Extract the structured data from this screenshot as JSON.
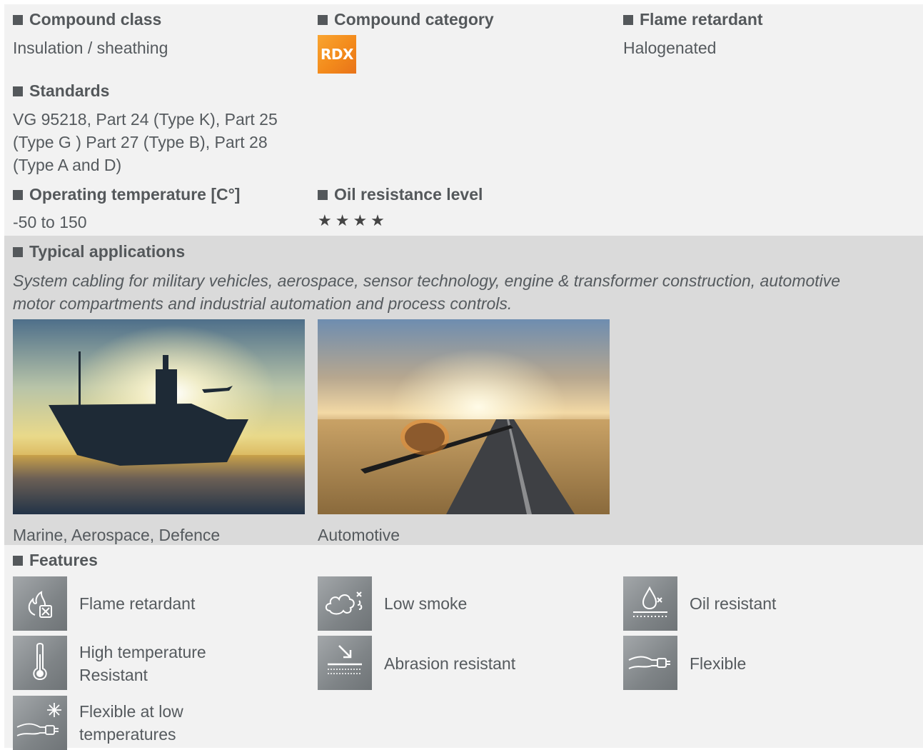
{
  "compound_class": {
    "label": "Compound class",
    "value": "Insulation / sheathing"
  },
  "compound_category": {
    "label": "Compound category",
    "badge": "RDX",
    "badge_color": "#f39222"
  },
  "flame_retardant": {
    "label": "Flame retardant",
    "value": "Halogenated"
  },
  "standards": {
    "label": "Standards",
    "lines": [
      "VG 95218, Part 24 (Type K), Part 25",
      "(Type G ) Part 27 (Type B), Part 28",
      "(Type A and D)"
    ]
  },
  "operating_temperature": {
    "label": "Operating temperature [C°]",
    "value": "-50 to 150"
  },
  "oil_resistance": {
    "label": "Oil resistance level",
    "stars": "★★★★",
    "rating": 4
  },
  "applications": {
    "label": "Typical applications",
    "description_lines": [
      "System cabling for military vehicles, aerospace, sensor technology, engine & transformer construction, automotive",
      "motor compartments and industrial automation and process controls."
    ],
    "images": [
      {
        "caption": "Marine, Aerospace, Defence",
        "icon": "aircraft-carrier-photo"
      },
      {
        "caption": "Automotive",
        "icon": "engine-on-road-photo"
      }
    ]
  },
  "features": {
    "label": "Features",
    "items": [
      {
        "lines": [
          "Flame retardant"
        ],
        "icon": "flame-retardant-icon"
      },
      {
        "lines": [
          "Low smoke"
        ],
        "icon": "low-smoke-icon"
      },
      {
        "lines": [
          "Oil resistant"
        ],
        "icon": "oil-resistant-icon"
      },
      {
        "lines": [
          "High temperature",
          "Resistant"
        ],
        "icon": "thermometer-icon"
      },
      {
        "lines": [
          "Abrasion resistant"
        ],
        "icon": "abrasion-resistant-icon"
      },
      {
        "lines": [
          "Flexible"
        ],
        "icon": "flexible-cable-icon"
      },
      {
        "lines": [
          "Flexible at low",
          "temperatures"
        ],
        "icon": "cold-flexible-icon"
      }
    ]
  },
  "colors": {
    "band_light": "#f2f2f2",
    "band_dark": "#dadada",
    "text": "#555a5e",
    "icon_tile": "#8a8e91"
  }
}
